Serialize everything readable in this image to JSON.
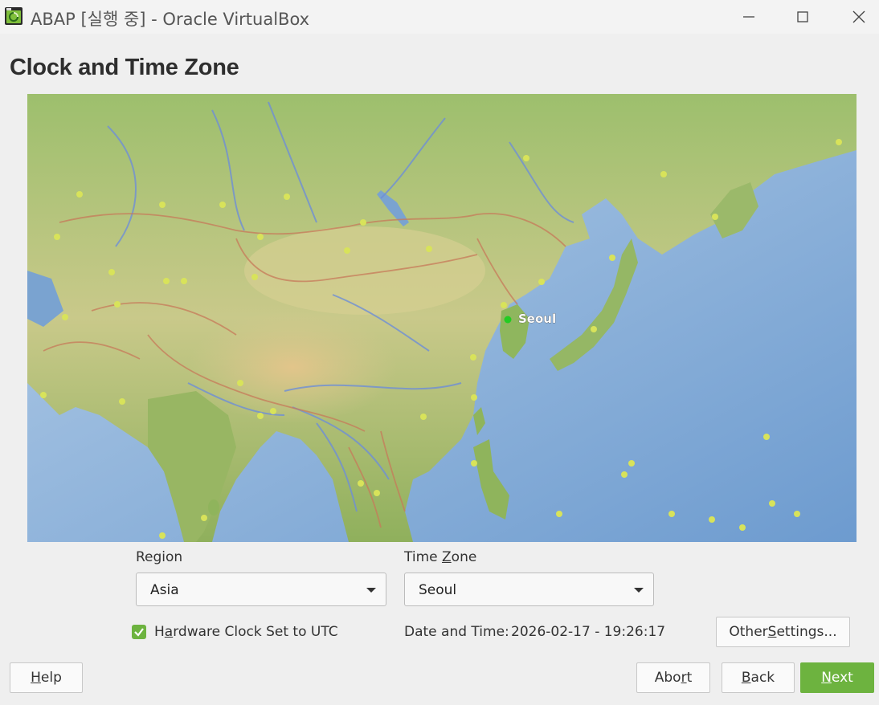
{
  "window": {
    "title": "ABAP [실행 중] - Oracle VirtualBox",
    "controls": [
      "minimize",
      "maximize",
      "close"
    ]
  },
  "page": {
    "title": "Clock and Time Zone"
  },
  "map": {
    "selected_city_label": "Seoul",
    "selected_color": "#22cc22"
  },
  "region": {
    "label": "Region",
    "value": "Asia"
  },
  "timezone": {
    "label_prefix": "Time ",
    "label_mnemonic": "Z",
    "label_suffix": "one",
    "value": "Seoul"
  },
  "hardware_clock": {
    "label_prefix": "H",
    "label_mnemonic": "a",
    "label_suffix": "rdware Clock Set to UTC",
    "checked": true
  },
  "datetime": {
    "label": "Date and Time:",
    "value": "2026-02-17 - 19:26:17"
  },
  "buttons": {
    "other_prefix": "Other ",
    "other_mnemonic": "S",
    "other_suffix": "ettings...",
    "help_mnemonic": "H",
    "help_suffix": "elp",
    "abort_prefix": "Abo",
    "abort_mnemonic": "r",
    "abort_suffix": "t",
    "back_mnemonic": "B",
    "back_suffix": "ack",
    "next_mnemonic": "N",
    "next_suffix": "ext"
  },
  "colors": {
    "accent": "#6db33f",
    "ocean": "#8fb4dc",
    "land": "#a9c27a"
  }
}
